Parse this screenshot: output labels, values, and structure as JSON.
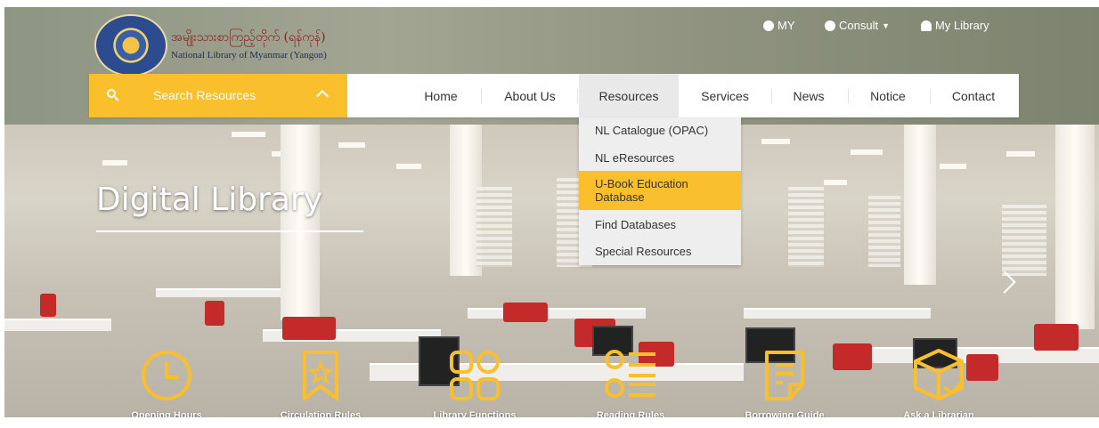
{
  "header": {
    "brand_my": "အမျိုးသားစာကြည့်တိုက် (ရန်ကုန်)",
    "brand_en": "National Library of Myanmar (Yangon)",
    "utility": [
      {
        "label": "MY",
        "icon": "globe-icon"
      },
      {
        "label": "Consult",
        "icon": "info-icon"
      },
      {
        "label": "My Library",
        "icon": "person-icon"
      }
    ]
  },
  "nav": {
    "search_label": "Search Resources",
    "items": [
      "Home",
      "About Us",
      "Resources",
      "Services",
      "News",
      "Notice",
      "Contact"
    ],
    "active": "Resources"
  },
  "dropdown": {
    "items": [
      "NL Catalogue (OPAC)",
      "NL eResources",
      "U-Book Education Database",
      "Find Databases",
      "Special Resources"
    ],
    "highlighted": "U-Book Education Database"
  },
  "hero": {
    "title": "Digital Library"
  },
  "quick_links": [
    {
      "label": "Opening Hours",
      "icon": "clock-icon"
    },
    {
      "label": "Circulation Rules",
      "icon": "bookmark-star-icon"
    },
    {
      "label": "Library Functions",
      "icon": "grid-icon"
    },
    {
      "label": "Reading Rules",
      "icon": "list-icon"
    },
    {
      "label": "Borrowing Guide",
      "icon": "document-icon"
    },
    {
      "label": "Ask a Librarian",
      "icon": "box-check-icon"
    }
  ],
  "colors": {
    "accent": "#f9bf2d",
    "header_band": "#9ea08e",
    "nav_bg": "#ffffff",
    "active_bg": "#e9e9e9"
  }
}
